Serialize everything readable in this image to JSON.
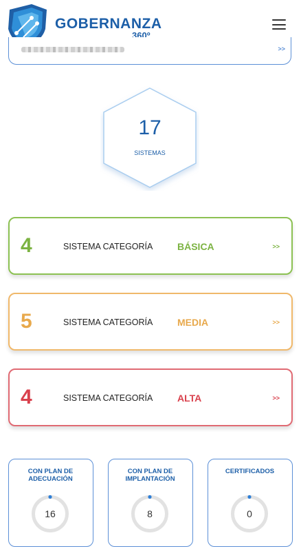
{
  "header": {
    "brand_title": "GOBERNANZA",
    "brand_subtitle": "360º",
    "logo_icon": "shield-circuit-icon",
    "menu_icon": "hamburger-menu-icon"
  },
  "search": {
    "arrow": ">>"
  },
  "summary": {
    "value": "17",
    "label": "SISTEMAS"
  },
  "categories": [
    {
      "count": "4",
      "text": "SISTEMA CATEGORÍA",
      "level": "BÁSICA",
      "arrow": ">>",
      "color": "#7cb342"
    },
    {
      "count": "5",
      "text": "SISTEMA CATEGORÍA",
      "level": "MEDIA",
      "arrow": ">>",
      "color": "#e8a94c"
    },
    {
      "count": "4",
      "text": "SISTEMA CATEGORÍA",
      "level": "ALTA",
      "arrow": ">>",
      "color": "#d9414d"
    }
  ],
  "stats": [
    {
      "title_line1": "CON PLAN DE",
      "title_line2": "ADECUACIÓN",
      "value": "16"
    },
    {
      "title_line1": "CON PLAN DE",
      "title_line2": "IMPLANTACIÓN",
      "value": "8"
    },
    {
      "title_line1": "CERTIFICADOS",
      "title_line2": "",
      "value": "0"
    }
  ],
  "colors": {
    "brand": "#1d5fa8",
    "accent_blue": "#5b8fd6"
  }
}
